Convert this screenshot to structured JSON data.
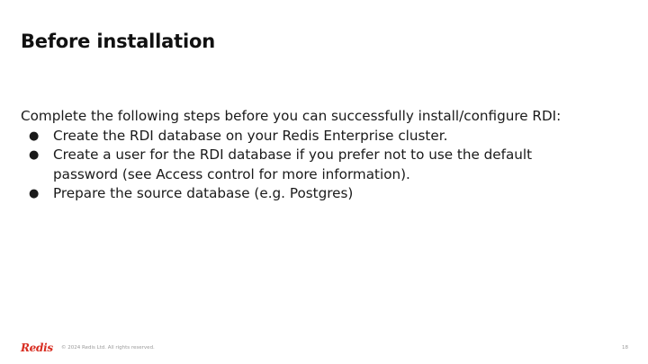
{
  "slide": {
    "title": "Before installation",
    "intro": "Complete the following steps before you can successfully install/configure RDI:",
    "bullet_glyph": "●",
    "steps": [
      {
        "line1": "Create the RDI database on your Redis Enterprise cluster."
      },
      {
        "line1": "Create a user for the RDI database if you prefer not to use the default",
        "line2": "password (see Access control for more information)."
      },
      {
        "line1": "Prepare the source database (e.g. Postgres)"
      }
    ]
  },
  "footer": {
    "logo_text": "Redis",
    "copyright": "© 2024 Redis Ltd. All rights reserved.",
    "page_number": "18"
  },
  "colors": {
    "brand": "#d82c20",
    "text": "#1a1a1a",
    "muted": "#9a9a9a"
  }
}
